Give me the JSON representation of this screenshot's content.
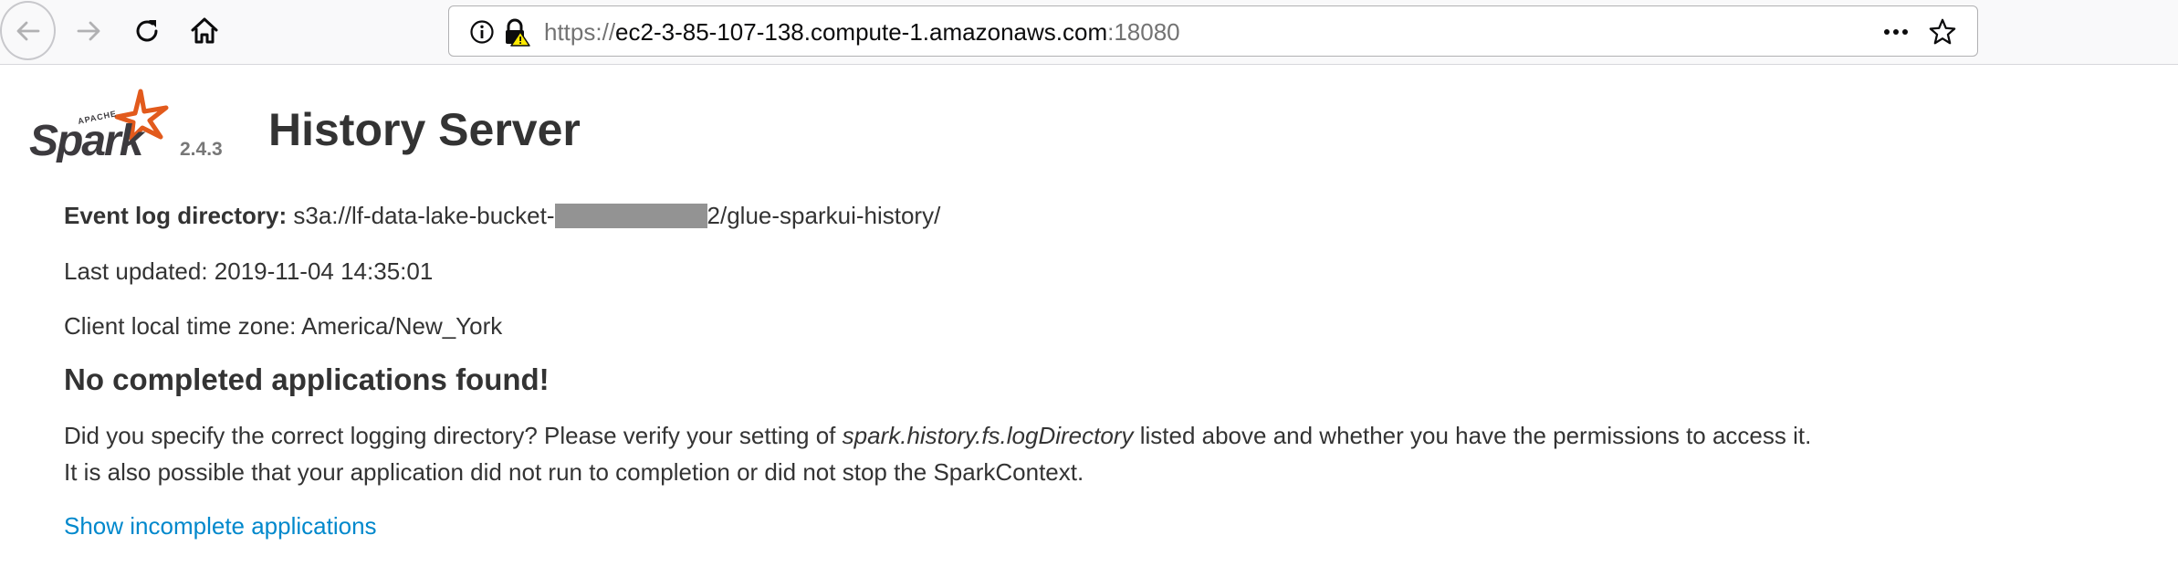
{
  "browser": {
    "url_scheme": "https://",
    "url_host": "ec2-3-85-107-138.compute-1.amazonaws.com",
    "url_port": ":18080",
    "icons": [
      "back-icon",
      "forward-icon",
      "reload-icon",
      "home-icon",
      "info-icon",
      "insecure-lock-icon",
      "page-actions-icon",
      "bookmark-star-icon"
    ]
  },
  "header": {
    "logo_small_text": "APACHE",
    "logo_text": "Spark",
    "version": "2.4.3",
    "title": "History Server"
  },
  "info": {
    "event_log_label": "Event log directory:",
    "event_log_prefix": "s3a://lf-data-lake-bucket-",
    "event_log_suffix": "2/glue-sparkui-history/",
    "last_updated": "Last updated: 2019-11-04 14:35:01",
    "timezone": "Client local time zone: America/New_York"
  },
  "message": {
    "heading": "No completed applications found!",
    "line1_pre": "Did you specify the correct logging directory? Please verify your setting of ",
    "line1_em": "spark.history.fs.logDirectory",
    "line1_post": " listed above and whether you have the permissions to access it.",
    "line2": "It is also possible that your application did not run to completion or did not stop the SparkContext."
  },
  "link": {
    "label": "Show incomplete applications"
  },
  "colors": {
    "link": "#0088cc",
    "spark_orange": "#e25a1c",
    "text": "#333333",
    "redaction": "#939393"
  }
}
